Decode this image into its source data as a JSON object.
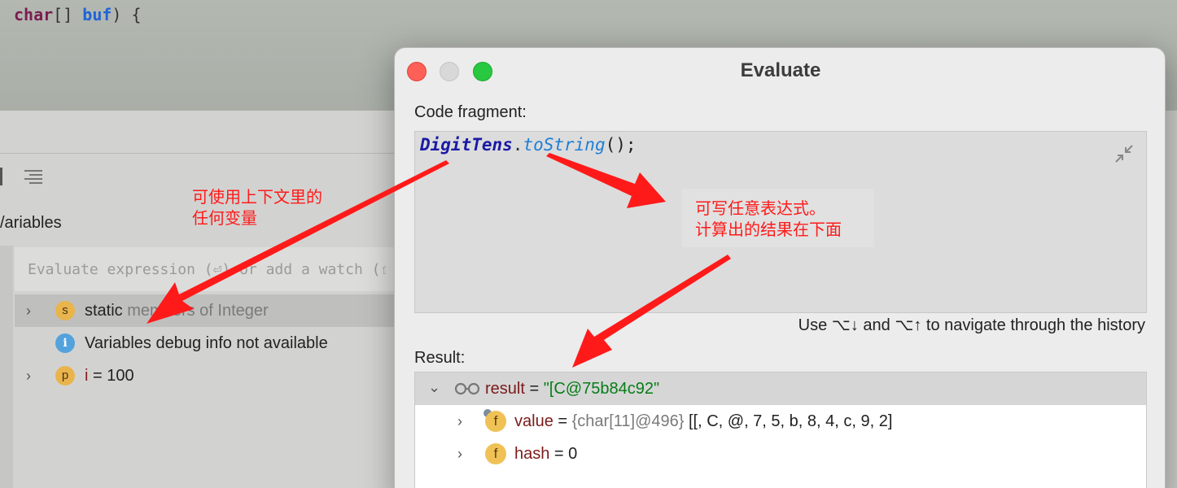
{
  "editor": {
    "code_char": "char",
    "code_brackets": "[] ",
    "code_buf": "buf",
    "code_tail": ") {"
  },
  "debug_panel": {
    "title": "/ariables",
    "eval_placeholder": "Evaluate expression (⏎) or add a watch (⇧⌘⏎)",
    "rows": [
      {
        "badge": "s",
        "text": "static ",
        "dim": "members of Integer",
        "expandable": true
      },
      {
        "badge": "i",
        "text": "Variables debug info not available",
        "expandable": false
      },
      {
        "badge": "p",
        "name": "i",
        "rest": " = 100",
        "expandable": true
      }
    ]
  },
  "dialog": {
    "title": "Evaluate",
    "code_label": "Code fragment:",
    "expr_class": "DigitTens",
    "expr_dot": ".",
    "expr_method": "toString",
    "expr_tail": "();",
    "history_hint": "Use ⌥↓ and ⌥↑ to navigate through the history",
    "result_label": "Result:",
    "result": {
      "name": "result",
      "eq": " = ",
      "value": "\"[C@75b84c92\"",
      "children": [
        {
          "badge": "f",
          "name": "value",
          "eq": " = ",
          "type": "{char[11]@496}",
          "rest": " [[, C, @, 7, 5, b, 8, 4, c, 9, 2]"
        },
        {
          "badge": "f",
          "name": "hash",
          "eq": " = ",
          "rest": "0"
        }
      ]
    }
  },
  "annotations": {
    "left_line1": "可使用上下文里的",
    "left_line2": "任何变量",
    "right_line1": "可写任意表达式。",
    "right_line2": "计算出的结果在下面"
  },
  "colors": {
    "annotation": "#ff1a1a",
    "close": "#fe5f57",
    "maximize": "#28c840",
    "string_value": "#067d17"
  }
}
